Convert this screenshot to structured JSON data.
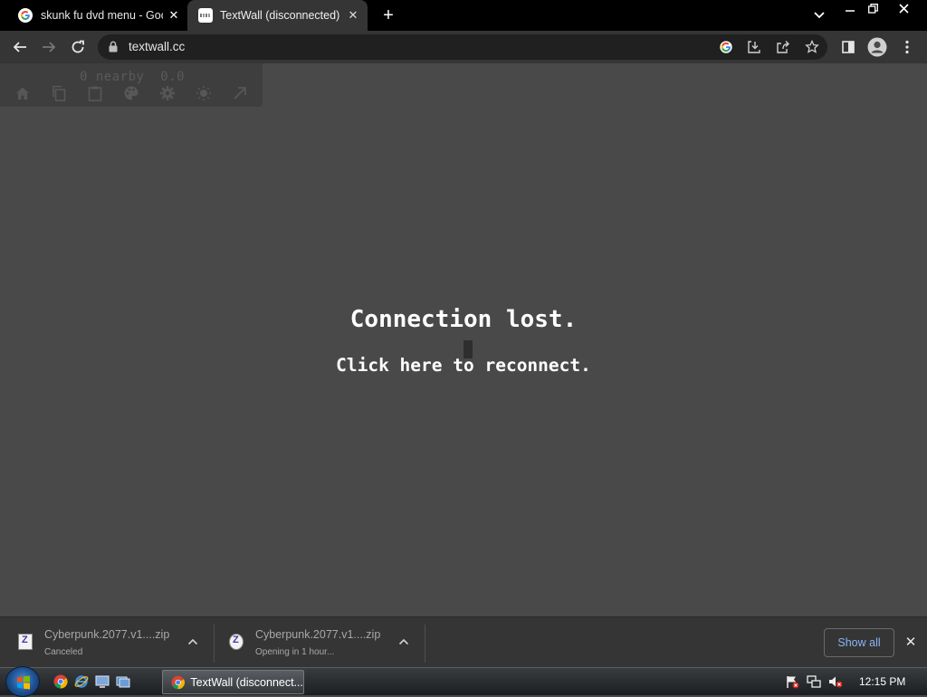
{
  "browser": {
    "tabs": [
      {
        "title": "skunk fu dvd menu - Goo",
        "active": false,
        "favicon": "google-g-icon"
      },
      {
        "title": "TextWall (disconnected)",
        "active": true,
        "favicon": "textwall-favicon"
      }
    ],
    "url": "textwall.cc"
  },
  "page": {
    "nearby_text": "0 nearby  0.0",
    "menu_icons": [
      "home-icon",
      "copy-icon",
      "clipboard-icon",
      "palette-icon",
      "gear-icon",
      "brightness-icon",
      "arrow-up-right-icon"
    ],
    "connection_title": "Connection lost.",
    "connection_subtitle": "Click here to reconnect.",
    "background_color": "#494949"
  },
  "downloads": {
    "items": [
      {
        "name": "Cyberpunk.2077.v1....zip",
        "status": "Canceled"
      },
      {
        "name": "Cyberpunk.2077.v1....zip",
        "status": "Opening in 1 hour..."
      }
    ],
    "show_all_label": "Show all"
  },
  "taskbar": {
    "task_title": "TextWall (disconnect...",
    "clock": "12:15 PM"
  },
  "colors": {
    "link_blue": "#8ab4f8",
    "toolbar": "#353535",
    "omnibox": "#202020"
  }
}
